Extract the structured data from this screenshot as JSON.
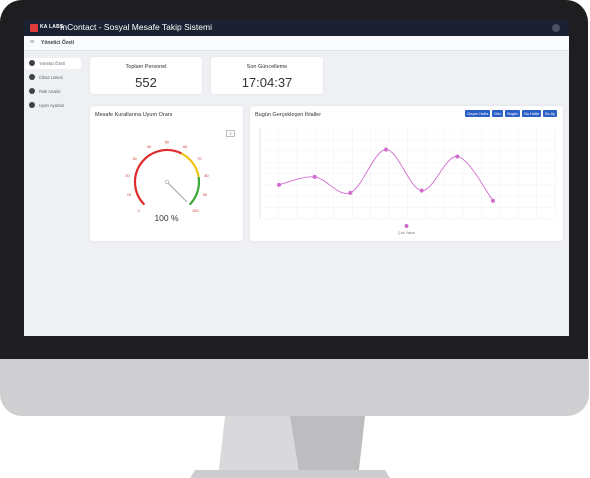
{
  "header": {
    "logo_text": "KA LABS",
    "title": "InContact - Sosyal Mesafe Takip Sistemi"
  },
  "subbar": {
    "title": "Yönetici Özeti"
  },
  "sidebar": {
    "items": [
      {
        "label": "Yönetici Özeti",
        "icon": "dashboard-icon",
        "active": true
      },
      {
        "label": "Cihaz Listesi",
        "icon": "list-icon",
        "active": false
      },
      {
        "label": "Risk Analizi",
        "icon": "analytics-icon",
        "active": false
      },
      {
        "label": "Uyarı Ayarları",
        "icon": "settings-icon",
        "active": false
      }
    ]
  },
  "stats": [
    {
      "title": "Toplam Personel",
      "value": "552"
    },
    {
      "title": "Son Güncelleme",
      "value": "17:04:37"
    }
  ],
  "gauge": {
    "title": "Mesafe Kurallarına Uyum Oranı",
    "value_label": "100 %",
    "value": 100,
    "min": 0,
    "max": 100,
    "ticks": [
      "0",
      "10",
      "20",
      "30",
      "40",
      "50",
      "60",
      "70",
      "80",
      "90",
      "100"
    ],
    "bands": [
      {
        "color": "#e02b2b",
        "from": 0,
        "to": 60
      },
      {
        "color": "#f0c419",
        "from": 60,
        "to": 80
      },
      {
        "color": "#3aa83a",
        "from": 80,
        "to": 100
      }
    ]
  },
  "line_panel": {
    "title": "Bugün Gerçekleşen İhlaller",
    "buttons": [
      "Geçen Hafta",
      "Dün",
      "Bugün",
      "Bu Hafta",
      "Bu Ay"
    ],
    "legend": "Çok Yakın"
  },
  "chart_data": {
    "type": "line",
    "series": [
      {
        "name": "Çok Yakın",
        "color": "#d16bd0",
        "values": [
          3,
          3.7,
          2.3,
          6.1,
          2.5,
          5.5,
          1.6
        ]
      }
    ],
    "ylim": [
      0,
      8
    ],
    "grid": true,
    "legend_position": "bottom"
  },
  "colors": {
    "accent": "#2a5fc8",
    "header": "#1b2130",
    "brand": "#e03b3b"
  }
}
